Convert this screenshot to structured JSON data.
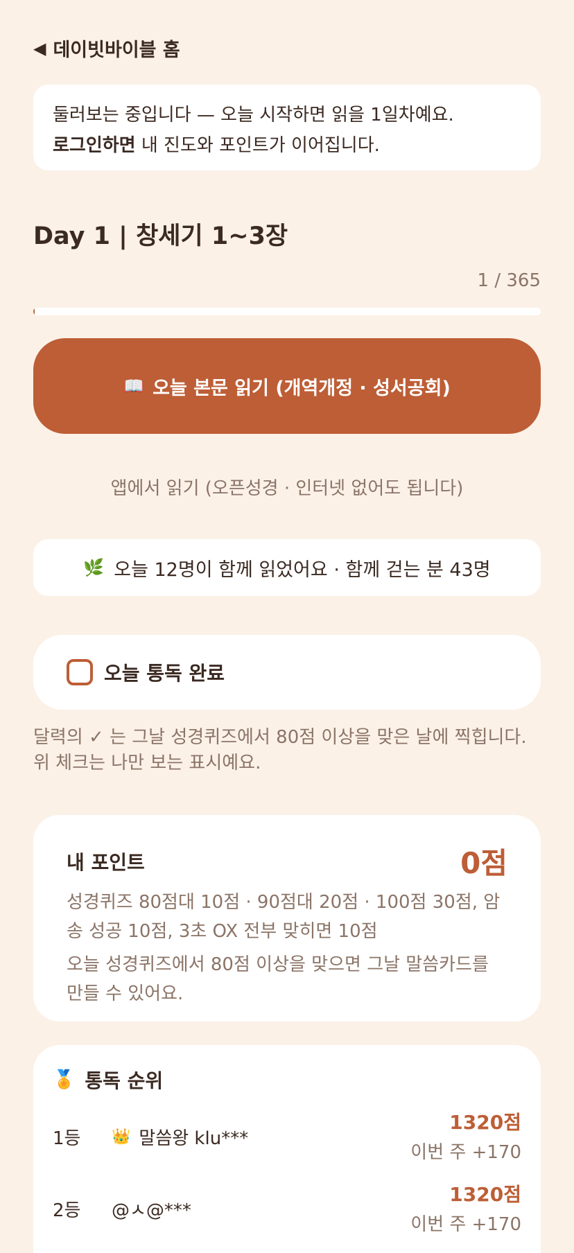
{
  "header": {
    "back_label": "데이빗바이블 홈"
  },
  "banner": {
    "line1": "둘러보는 중입니다 — 오늘 시작하면 읽을 1일차예요.",
    "line2_bold": "로그인하면",
    "line2_rest": " 내 진도와 포인트가 이어집니다."
  },
  "reading": {
    "day_title": "Day 1 | 창세기 1~3장",
    "progress_text": "1 / 365",
    "progress_fraction": 0.0027,
    "button_label": "오늘 본문 읽기 (개역개정 · 성서공회)",
    "button_icon": "book-icon",
    "app_read_label": "앱에서 읽기 (오픈성경 · 인터넷 없어도 됩니다)"
  },
  "community": {
    "icon": "leaf-icon",
    "text": "오늘 12명이 함께 읽었어요 · 함께 걷는 분 43명"
  },
  "completion": {
    "label": "오늘 통독 완료",
    "checked": false,
    "note": "달력의 ✓ 는 그날 성경퀴즈에서 80점 이상을 맞은 날에 찍힙니다. 위 체크는 나만 보는 표시예요."
  },
  "points": {
    "title": "내 포인트",
    "value": "0점",
    "description": "성경퀴즈 80점대 10점 · 90점대 20점 · 100점 30점, 암송 성공 10점, 3초 OX 전부 맞히면 10점",
    "tip": "오늘 성경퀴즈에서 80점 이상을 맞으면 그날 말씀카드를 만들 수 있어요."
  },
  "ranking": {
    "title": "통독 순위",
    "rows": [
      {
        "rank": "1등",
        "name": "말씀왕 klu***",
        "crown": true,
        "score": "1320점",
        "week": "이번 주 +170"
      },
      {
        "rank": "2등",
        "name": "@ㅅ@***",
        "crown": false,
        "score": "1320점",
        "week": "이번 주 +170"
      }
    ]
  },
  "colors": {
    "accent": "#bd5e36",
    "background": "#fbf1e7",
    "muted": "#8b7467"
  }
}
